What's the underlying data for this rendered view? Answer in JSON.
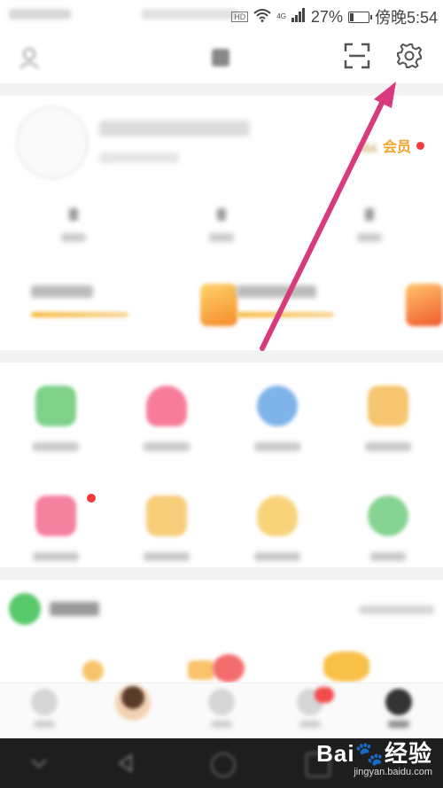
{
  "status_bar": {
    "battery_percent": "27%",
    "network_label": "4G",
    "hd_label": "HD",
    "time": "傍晚5:54",
    "battery_level": 0.27
  },
  "profile": {
    "vip_label": "会员"
  },
  "watermark": {
    "brand": "Bai",
    "brand_suffix": "经验",
    "site": "jingyan.baidu.com"
  },
  "colors": {
    "accent_orange": "#f0a52b",
    "annotation_arrow": "#d83a7d",
    "badge_red": "#f13b3b"
  },
  "icons": {
    "scan": "scan-icon",
    "settings": "gear-icon",
    "crown": "crown-icon"
  }
}
